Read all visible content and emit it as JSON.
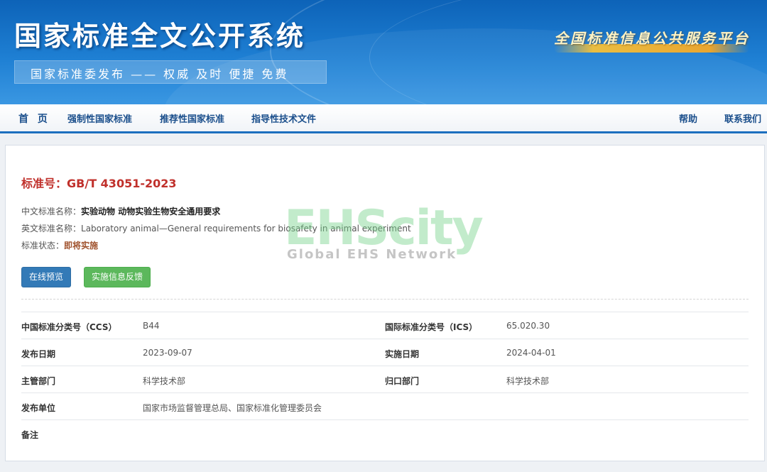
{
  "header": {
    "site_title": "国家标准全文公开系统",
    "slogan": "国家标准委发布 —— 权威 及时 便捷 免费",
    "platform": "全国标准信息公共服务平台"
  },
  "nav": {
    "home": "首 页",
    "mandatory": "强制性国家标准",
    "recommended": "推荐性国家标准",
    "guidance": "指导性技术文件",
    "help": "帮助",
    "contact": "联系我们"
  },
  "standard": {
    "number_label": "标准号：",
    "number": "GB/T 43051-2023",
    "cn_name_label": "中文标准名称：",
    "cn_name": "实验动物 动物实验生物安全通用要求",
    "en_name_label": "英文标准名称：",
    "en_name": "Laboratory animal—General requirements for biosafety in animal experiment",
    "status_label": "标准状态：",
    "status": "即将实施"
  },
  "buttons": {
    "preview": "在线预览",
    "feedback": "实施信息反馈"
  },
  "details": [
    {
      "label1": "中国标准分类号（CCS）",
      "value1": "B44",
      "label2": "国际标准分类号（ICS）",
      "value2": "65.020.30"
    },
    {
      "label1": "发布日期",
      "value1": "2023-09-07",
      "label2": "实施日期",
      "value2": "2024-04-01"
    },
    {
      "label1": "主管部门",
      "value1": "科学技术部",
      "label2": "归口部门",
      "value2": "科学技术部"
    },
    {
      "label1": "发布单位",
      "value1": "国家市场监督管理总局、国家标准化管理委员会",
      "label2": "",
      "value2": ""
    },
    {
      "label1": "备注",
      "value1": "",
      "label2": "",
      "value2": ""
    }
  ],
  "watermark": {
    "brand": "EHScity",
    "tagline": "Global EHS Network"
  },
  "colors": {
    "banner_blue": "#1e7fd3",
    "nav_text": "#1b4f8c",
    "title_red": "#c0302b",
    "status_brown": "#a0522d",
    "preview_blue": "#337ab7",
    "feedback_green": "#5cb85c"
  }
}
